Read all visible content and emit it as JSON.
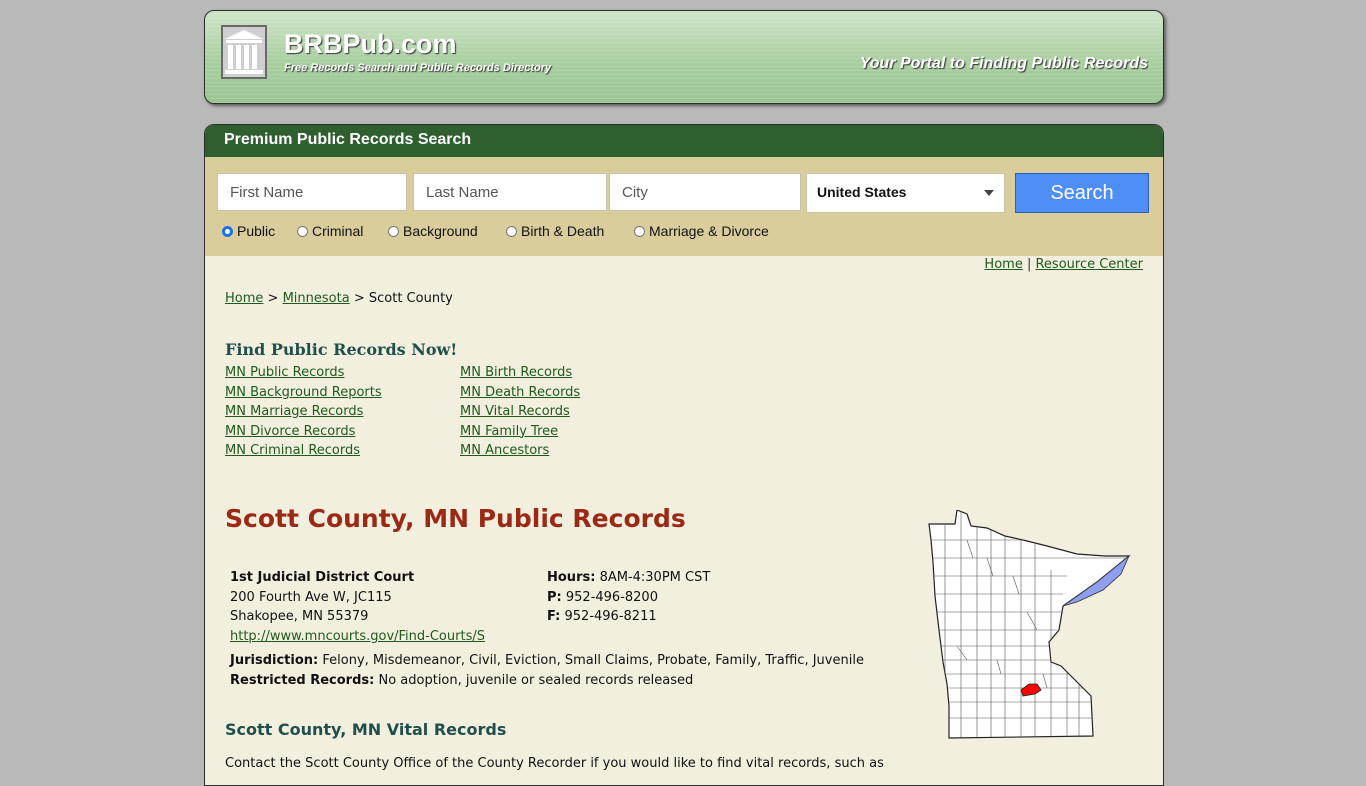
{
  "header": {
    "site_name": "BRBPub.com",
    "tagline": "Free Records Search and Public Records Directory",
    "portal_text": "Your Portal to Finding Public Records"
  },
  "search": {
    "heading": "Premium Public Records Search",
    "first_name_placeholder": "First Name",
    "last_name_placeholder": "Last Name",
    "city_placeholder": "City",
    "country_selected": "United States",
    "button_label": "Search",
    "record_types": [
      "Public",
      "Criminal",
      "Background",
      "Birth & Death",
      "Marriage & Divorce"
    ],
    "selected_type": "Public"
  },
  "toplinks": {
    "home": "Home",
    "resource": "Resource Center",
    "sep": "|"
  },
  "breadcrumb": {
    "home": "Home",
    "state": "Minnesota",
    "current": "Scott County",
    "sep": ">"
  },
  "find": {
    "title": "Find Public Records Now!",
    "left": [
      "MN Public Records",
      "MN Background Reports",
      "MN Marriage Records",
      "MN Divorce Records",
      "MN Criminal Records"
    ],
    "right": [
      "MN Birth Records",
      "MN Death Records",
      "MN Vital Records",
      "MN Family Tree",
      "MN Ancestors"
    ]
  },
  "county": {
    "title": "Scott County, MN Public Records",
    "court_name": "1st Judicial District Court",
    "address1": "200 Fourth Ave W, JC115",
    "address2": "Shakopee, MN 55379",
    "url": "http://www.mncourts.gov/Find-Courts/S",
    "hours_label": "Hours:",
    "hours_value": "8AM-4:30PM CST",
    "phone_label": "P:",
    "phone_value": "952-496-8200",
    "fax_label": "F:",
    "fax_value": "952-496-8211",
    "jurisdiction_label": "Jurisdiction:",
    "jurisdiction_value": "Felony, Misdemeanor, Civil, Eviction, Small Claims, Probate, Family, Traffic, Juvenile",
    "restricted_label": "Restricted Records:",
    "restricted_value": "No adoption, juvenile or sealed records released"
  },
  "vital": {
    "title": "Scott County, MN Vital Records",
    "text": "Contact the Scott County Office of the County Recorder if you would like to find vital records, such as"
  },
  "colors": {
    "header_green": "#2f5f2f",
    "title_red": "#9a2a16",
    "search_blue": "#4f8ef7",
    "highlight": "#ff0000"
  }
}
